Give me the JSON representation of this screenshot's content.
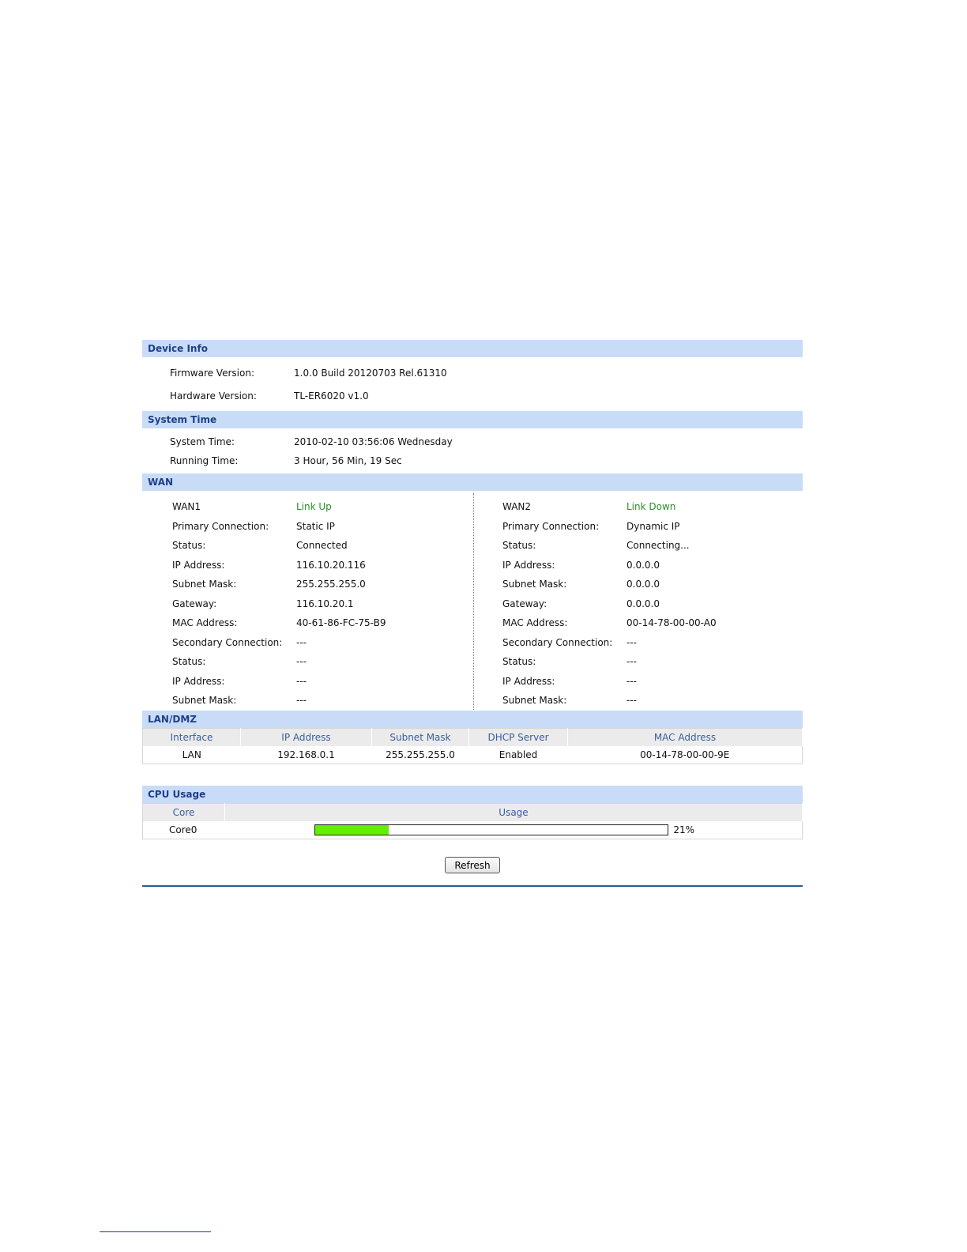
{
  "device_info": {
    "title": "Device Info",
    "rows": [
      {
        "label": "Firmware Version:",
        "value": "1.0.0 Build 20120703 Rel.61310"
      },
      {
        "label": "Hardware Version:",
        "value": "TL-ER6020 v1.0"
      }
    ]
  },
  "system_time": {
    "title": "System Time",
    "rows": [
      {
        "label": "System Time:",
        "value": "2010-02-10 03:56:06 Wednesday"
      },
      {
        "label": "Running Time:",
        "value": "3 Hour, 56 Min, 19 Sec"
      }
    ]
  },
  "wan": {
    "title": "WAN",
    "wan1": {
      "rows": [
        {
          "label": "WAN1",
          "value": "Link Up"
        },
        {
          "label": "Primary Connection:",
          "value": "Static IP"
        },
        {
          "label": "Status:",
          "value": "Connected"
        },
        {
          "label": "IP Address:",
          "value": "116.10.20.116"
        },
        {
          "label": "Subnet Mask:",
          "value": "255.255.255.0"
        },
        {
          "label": "Gateway:",
          "value": "116.10.20.1"
        },
        {
          "label": "MAC Address:",
          "value": "40-61-86-FC-75-B9"
        },
        {
          "label": "Secondary Connection:",
          "value": "---"
        },
        {
          "label": "Status:",
          "value": "---"
        },
        {
          "label": "IP Address:",
          "value": "---"
        },
        {
          "label": "Subnet Mask:",
          "value": "---"
        }
      ]
    },
    "wan2": {
      "rows": [
        {
          "label": "WAN2",
          "value": "Link Down"
        },
        {
          "label": "Primary Connection:",
          "value": "Dynamic IP"
        },
        {
          "label": "Status:",
          "value": "Connecting..."
        },
        {
          "label": "IP Address:",
          "value": "0.0.0.0"
        },
        {
          "label": "Subnet Mask:",
          "value": "0.0.0.0"
        },
        {
          "label": "Gateway:",
          "value": "0.0.0.0"
        },
        {
          "label": "MAC Address:",
          "value": "00-14-78-00-00-A0"
        },
        {
          "label": "Secondary Connection:",
          "value": "---"
        },
        {
          "label": "Status:",
          "value": "---"
        },
        {
          "label": "IP Address:",
          "value": "---"
        },
        {
          "label": "Subnet Mask:",
          "value": "---"
        }
      ]
    },
    "link_color": "#2a8f2a"
  },
  "lan_dmz": {
    "title": "LAN/DMZ",
    "headers": [
      "Interface",
      "IP Address",
      "Subnet Mask",
      "DHCP Server",
      "MAC Address"
    ],
    "rows": [
      [
        "LAN",
        "192.168.0.1",
        "255.255.255.0",
        "Enabled",
        "00-14-78-00-00-9E"
      ]
    ]
  },
  "cpu_usage": {
    "title": "CPU Usage",
    "headers": [
      "Core",
      "Usage"
    ],
    "cores": [
      {
        "name": "Core0",
        "usage_percent": 21,
        "usage_label": "21%"
      }
    ],
    "bar_color": "#66ee00"
  },
  "actions": {
    "refresh_label": "Refresh"
  },
  "colors": {
    "section_header_bg": "#c8dcf8",
    "section_header_text": "#1f3f8a",
    "table_header_text": "#3b5da0",
    "bottom_rule": "#2a5a9a"
  }
}
